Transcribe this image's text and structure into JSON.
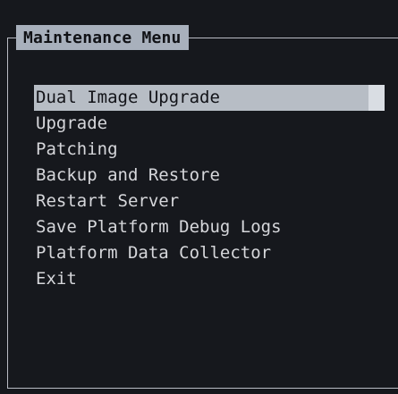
{
  "window": {
    "title": "Maintenance Menu"
  },
  "menu": {
    "items": [
      {
        "label": "Dual Image Upgrade",
        "selected": true
      },
      {
        "label": "Upgrade",
        "selected": false
      },
      {
        "label": "Patching",
        "selected": false
      },
      {
        "label": "Backup and Restore",
        "selected": false
      },
      {
        "label": "Restart Server",
        "selected": false
      },
      {
        "label": "Save Platform Debug Logs",
        "selected": false
      },
      {
        "label": "Platform Data Collector",
        "selected": false
      },
      {
        "label": "Exit",
        "selected": false
      }
    ]
  },
  "colors": {
    "background": "#16181d",
    "border": "#b9bcc4",
    "title_background": "#a8b0bc",
    "selection_background": "#b7bdc5",
    "text": "#d6d7db",
    "selected_text": "#121318"
  }
}
